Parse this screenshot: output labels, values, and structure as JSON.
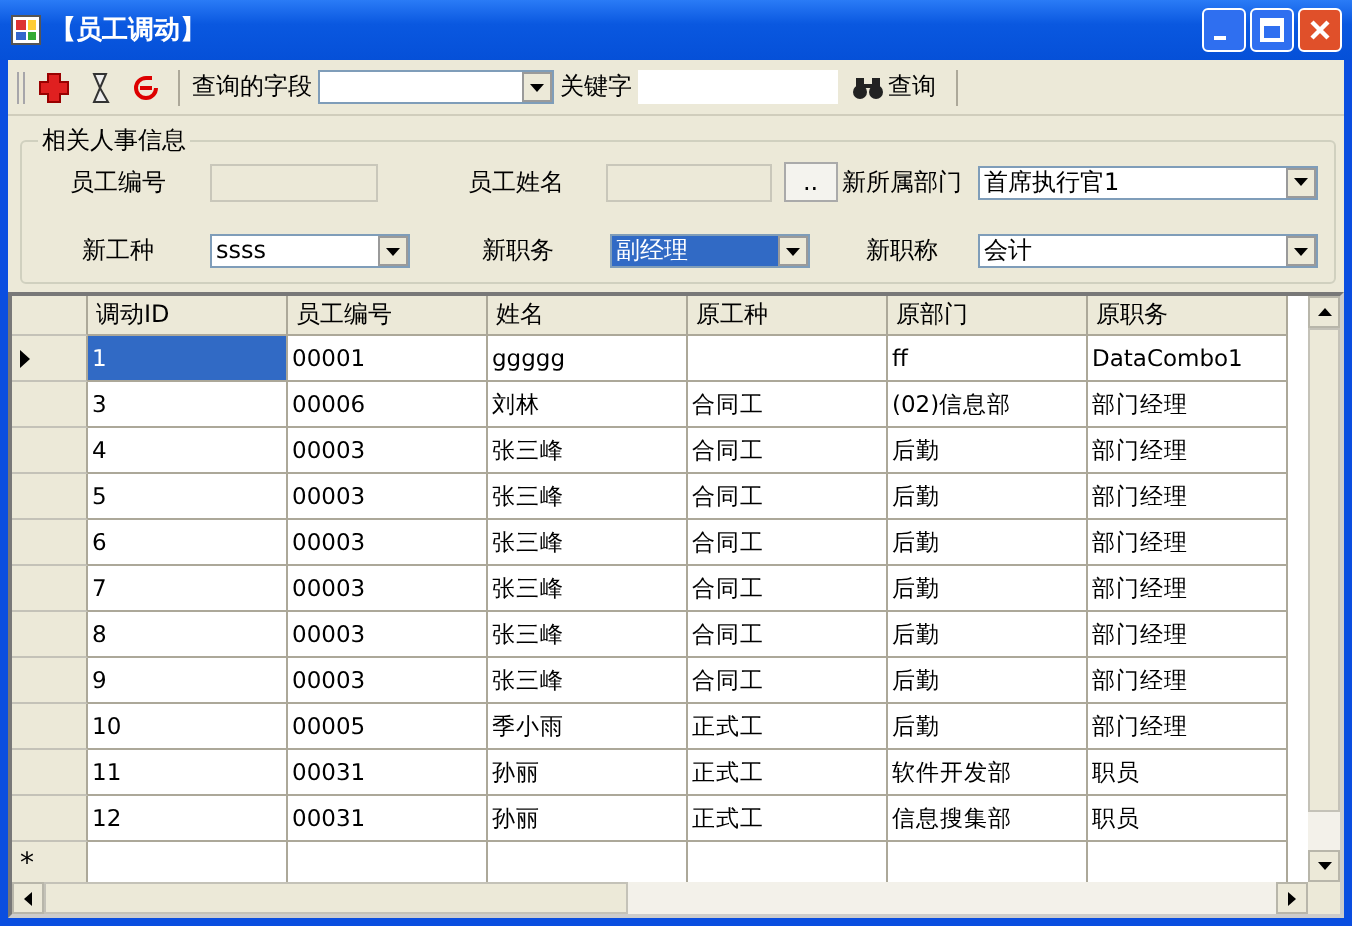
{
  "window": {
    "title": "【员工调动】"
  },
  "toolbar": {
    "field_label": "查询的字段",
    "keyword_label": "关键字",
    "search_button": "查询"
  },
  "group": {
    "title": "相关人事信息",
    "fields": [
      {
        "kind": "text",
        "label": "员工编号",
        "disabled": true
      },
      {
        "kind": "browse",
        "label": "员工姓名",
        "disabled": true,
        "button": ".."
      },
      {
        "kind": "combo",
        "label": "新所属部门",
        "value": "首席执行官1",
        "focused": false
      },
      {
        "kind": "combo",
        "label": "新工种",
        "value": "ssss",
        "focused": false
      },
      {
        "kind": "combo",
        "label": "新职务",
        "value": "副经理",
        "focused": true
      },
      {
        "kind": "combo",
        "label": "新职称",
        "value": "会计",
        "focused": false
      }
    ]
  },
  "table": {
    "columns": [
      "调动ID",
      "员工编号",
      "姓名",
      "原工种",
      "原部门",
      "原职务"
    ],
    "rows": [
      {
        "selected": true,
        "cells": [
          "1",
          "00001",
          "ggggg",
          "",
          "ff",
          "DataCombo1"
        ]
      },
      {
        "selected": false,
        "cells": [
          "3",
          "00006",
          "刘林",
          "合同工",
          "(02)信息部",
          "部门经理"
        ]
      },
      {
        "selected": false,
        "cells": [
          "4",
          "00003",
          "张三峰",
          "合同工",
          "后勤",
          "部门经理"
        ]
      },
      {
        "selected": false,
        "cells": [
          "5",
          "00003",
          "张三峰",
          "合同工",
          "后勤",
          "部门经理"
        ]
      },
      {
        "selected": false,
        "cells": [
          "6",
          "00003",
          "张三峰",
          "合同工",
          "后勤",
          "部门经理"
        ]
      },
      {
        "selected": false,
        "cells": [
          "7",
          "00003",
          "张三峰",
          "合同工",
          "后勤",
          "部门经理"
        ]
      },
      {
        "selected": false,
        "cells": [
          "8",
          "00003",
          "张三峰",
          "合同工",
          "后勤",
          "部门经理"
        ]
      },
      {
        "selected": false,
        "cells": [
          "9",
          "00003",
          "张三峰",
          "合同工",
          "后勤",
          "部门经理"
        ]
      },
      {
        "selected": false,
        "cells": [
          "10",
          "00005",
          "季小雨",
          "正式工",
          "后勤",
          "部门经理"
        ]
      },
      {
        "selected": false,
        "cells": [
          "11",
          "00031",
          "孙丽",
          "正式工",
          "软件开发部",
          "职员"
        ]
      },
      {
        "selected": false,
        "cells": [
          "12",
          "00031",
          "孙丽",
          "正式工",
          "信息搜集部",
          "职员"
        ]
      }
    ],
    "new_row_marker": "*"
  }
}
